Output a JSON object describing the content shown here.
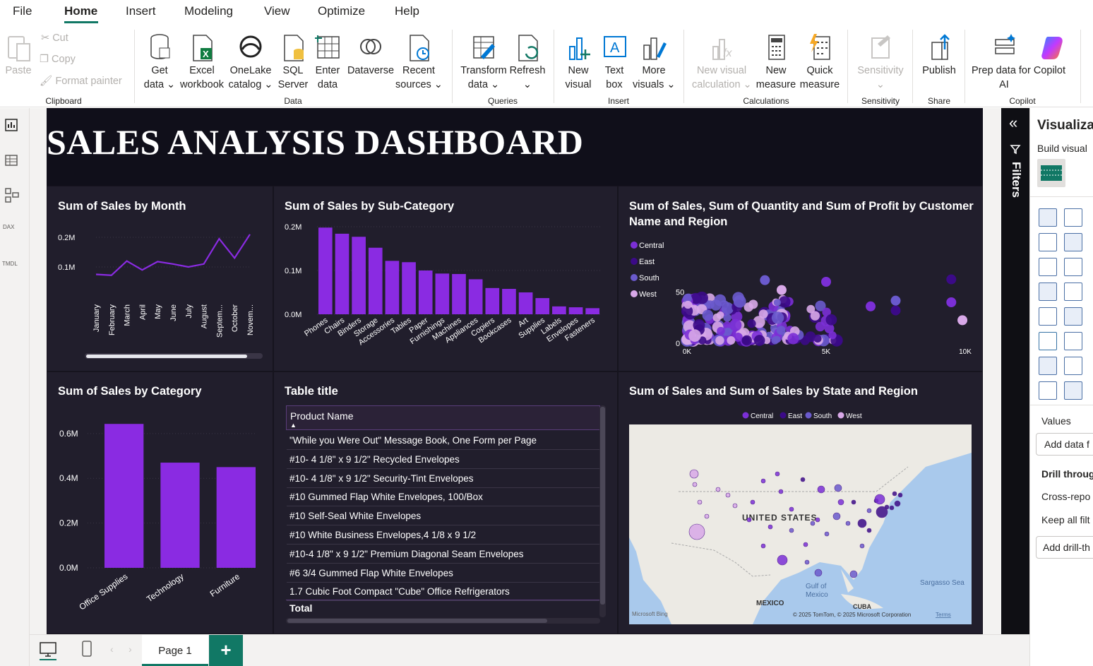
{
  "menu": {
    "file": "File",
    "home": "Home",
    "insert": "Insert",
    "modeling": "Modeling",
    "view": "View",
    "optimize": "Optimize",
    "help": "Help"
  },
  "ribbon": {
    "clipboard": {
      "paste": "Paste",
      "cut": "Cut",
      "copy": "Copy",
      "format_painter": "Format painter",
      "group": "Clipboard"
    },
    "data": {
      "get_data": [
        "Get",
        "data"
      ],
      "excel": [
        "Excel",
        "workbook"
      ],
      "onelake": [
        "OneLake",
        "catalog"
      ],
      "sql": [
        "SQL",
        "Server"
      ],
      "enter": [
        "Enter",
        "data"
      ],
      "dataverse": "Dataverse",
      "recent": [
        "Recent",
        "sources"
      ],
      "group": "Data"
    },
    "queries": {
      "transform": [
        "Transform",
        "data"
      ],
      "refresh": "Refresh",
      "group": "Queries"
    },
    "insert": {
      "new_visual": [
        "New",
        "visual"
      ],
      "text_box": [
        "Text",
        "box"
      ],
      "more_visuals": [
        "More",
        "visuals"
      ],
      "group": "Insert"
    },
    "calculations": {
      "new_visual_calc": [
        "New visual",
        "calculation"
      ],
      "new_measure": [
        "New",
        "measure"
      ],
      "quick_measure": [
        "Quick",
        "measure"
      ],
      "group": "Calculations"
    },
    "sensitivity": {
      "label": "Sensitivity",
      "group": "Sensitivity"
    },
    "share": {
      "publish": "Publish",
      "group": "Share"
    },
    "copilot": {
      "prep": [
        "Prep data for Copilot",
        "AI"
      ],
      "group": "Copilot"
    }
  },
  "left_rail": {
    "dax": "DAX",
    "tmdl": "TMDL"
  },
  "dashboard": {
    "title": "SALES ANALYSIS DASHBOARD"
  },
  "colors": {
    "accent": "#8a2be2",
    "purple": "#7b2fd6",
    "bg": "#211e2c",
    "green": "#117865"
  },
  "visuals": {
    "month": {
      "title": "Sum of Sales by Month"
    },
    "subcat": {
      "title": "Sum of Sales by Sub-Category"
    },
    "scatter": {
      "title": [
        "Sum of Sales, Sum of Quantity and Sum of Profit by Customer",
        "Name and Region"
      ]
    },
    "category": {
      "title": "Sum of Sales by Category"
    },
    "table": {
      "title": "Table title",
      "header": "Product Name",
      "rows": [
        "\"While you Were Out\" Message Book, One Form per Page",
        "#10- 4 1/8\" x 9 1/2\" Recycled Envelopes",
        "#10- 4 1/8\" x 9 1/2\" Security-Tint Envelopes",
        "#10 Gummed Flap White Envelopes, 100/Box",
        "#10 Self-Seal White Envelopes",
        "#10 White Business Envelopes,4 1/8 x 9 1/2",
        "#10-4 1/8\" x 9 1/2\" Premium Diagonal Seam Envelopes",
        "#6 3/4 Gummed Flap White Envelopes",
        "1.7 Cubic Foot Compact \"Cube\" Office Refrigerators"
      ],
      "total": "Total"
    },
    "map": {
      "title": "Sum of Sales and Sum of Sales by State and Region",
      "legend": [
        "Central",
        "East",
        "South",
        "West"
      ],
      "labels": {
        "country": "UNITED STATES",
        "gulf": [
          "Gulf of",
          "Mexico"
        ],
        "mexico": "MEXICO",
        "cuba": "CUBA",
        "sargasso": "Sargasso Sea",
        "bing": "Microsoft Bing",
        "copyright": "© 2025 TomTom, © 2025 Microsoft Corporation",
        "terms": "Terms"
      }
    }
  },
  "chart_data": [
    {
      "type": "line",
      "title": "Sum of Sales by Month",
      "categories": [
        "January",
        "February",
        "March",
        "April",
        "May",
        "June",
        "July",
        "August",
        "Septem...",
        "October",
        "Novem..."
      ],
      "values": [
        0.075,
        0.072,
        0.12,
        0.09,
        0.118,
        0.11,
        0.1,
        0.11,
        0.195,
        0.13,
        0.21
      ],
      "yticks": [
        "0.1M",
        "0.2M"
      ],
      "ylim": [
        0,
        0.25
      ]
    },
    {
      "type": "bar",
      "title": "Sum of Sales by Sub-Category",
      "categories": [
        "Phones",
        "Chairs",
        "Binders",
        "Storage",
        "Accessories",
        "Tables",
        "Paper",
        "Furnishings",
        "Machines",
        "Appliances",
        "Copiers",
        "Bookcases",
        "Art",
        "Supplies",
        "Labels",
        "Envelopes",
        "Fasteners"
      ],
      "values": [
        0.198,
        0.184,
        0.177,
        0.152,
        0.122,
        0.119,
        0.1,
        0.093,
        0.092,
        0.08,
        0.06,
        0.058,
        0.05,
        0.037,
        0.018,
        0.016,
        0.014
      ],
      "yticks": [
        "0.0M",
        "0.1M",
        "0.2M"
      ],
      "ylim": [
        0,
        0.2
      ]
    },
    {
      "type": "scatter",
      "title": "Sum of Sales, Sum of Quantity and Sum of Profit by Customer Name and Region",
      "series": [
        {
          "name": "Central"
        },
        {
          "name": "East"
        },
        {
          "name": "South"
        },
        {
          "name": "West"
        }
      ],
      "xticks": [
        "0K",
        "5K",
        "10K"
      ],
      "yticks": [
        "0",
        "50"
      ],
      "xlim": [
        0,
        10000
      ],
      "ylim": [
        0,
        80
      ]
    },
    {
      "type": "bar",
      "title": "Sum of Sales by Category",
      "categories": [
        "Office Supplies",
        "Technology",
        "Furniture"
      ],
      "values": [
        0.643,
        0.47,
        0.45
      ],
      "yticks": [
        "0.0M",
        "0.2M",
        "0.4M",
        "0.6M"
      ],
      "ylim": [
        0,
        0.65
      ]
    }
  ],
  "viz_pane": {
    "title": "Visualiza",
    "build": "Build visual",
    "values": "Values",
    "add_data": "Add data f",
    "drill": "Drill throug",
    "cross": "Cross-repo",
    "keep": "Keep all filt",
    "add_drill": "Add drill-th"
  },
  "filters": {
    "label": "Filters"
  },
  "pages": {
    "page1": "Page 1",
    "add": "+"
  }
}
